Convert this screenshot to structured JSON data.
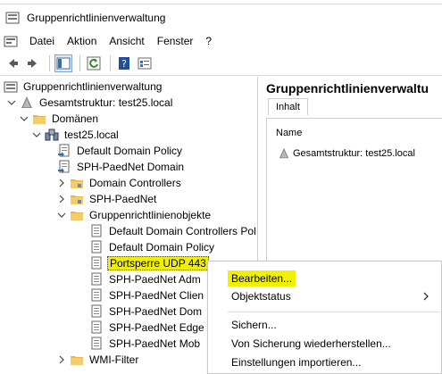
{
  "window": {
    "title": "Gruppenrichtlinienverwaltung"
  },
  "menubar": {
    "items": [
      "Datei",
      "Aktion",
      "Ansicht",
      "Fenster",
      "?"
    ]
  },
  "toolbar": {
    "buttons": [
      "back-icon",
      "forward-icon",
      "show-tree-icon",
      "refresh-icon",
      "help-icon",
      "properties-icon"
    ]
  },
  "tree": {
    "items": [
      {
        "label": "Gruppenrichtlinienverwaltung",
        "icon": "gpm-root-icon"
      },
      {
        "label": "Gesamtstruktur: test25.local",
        "icon": "forest-icon"
      },
      {
        "label": "Domänen",
        "icon": "folder-icon"
      },
      {
        "label": "test25.local",
        "icon": "domain-icon"
      },
      {
        "label": "Default Domain Policy",
        "icon": "gpo-link-icon"
      },
      {
        "label": "SPH-PaedNet Domain",
        "icon": "gpo-link-icon"
      },
      {
        "label": "Domain Controllers",
        "icon": "ou-icon"
      },
      {
        "label": "SPH-PaedNet",
        "icon": "ou-icon"
      },
      {
        "label": "Gruppenrichtlinienobjekte",
        "icon": "folder-icon"
      },
      {
        "label": "Default Domain Controllers Pol",
        "icon": "gpo-icon"
      },
      {
        "label": "Default Domain Policy",
        "icon": "gpo-icon"
      },
      {
        "label": "Portsperre UDP 443",
        "icon": "gpo-icon"
      },
      {
        "label": "SPH-PaedNet Adm",
        "icon": "gpo-icon"
      },
      {
        "label": "SPH-PaedNet Clien",
        "icon": "gpo-icon"
      },
      {
        "label": "SPH-PaedNet Dom",
        "icon": "gpo-icon"
      },
      {
        "label": "SPH-PaedNet Edge",
        "icon": "gpo-icon"
      },
      {
        "label": "SPH-PaedNet Mob",
        "icon": "gpo-icon"
      },
      {
        "label": "WMI-Filter",
        "icon": "folder-icon"
      }
    ]
  },
  "right_pane": {
    "header": "Gruppenrichtlinienverwaltu",
    "tab": "Inhalt",
    "column_header": "Name",
    "item": "Gesamtstruktur: test25.local"
  },
  "context_menu": {
    "items": [
      "Bearbeiten...",
      "Objektstatus",
      "Sichern...",
      "Von Sicherung wiederherstellen...",
      "Einstellungen importieren..."
    ]
  },
  "colors": {
    "highlight": "#f0f000",
    "folder": "#e8b64a",
    "selection_border": "#7aa7d8"
  }
}
